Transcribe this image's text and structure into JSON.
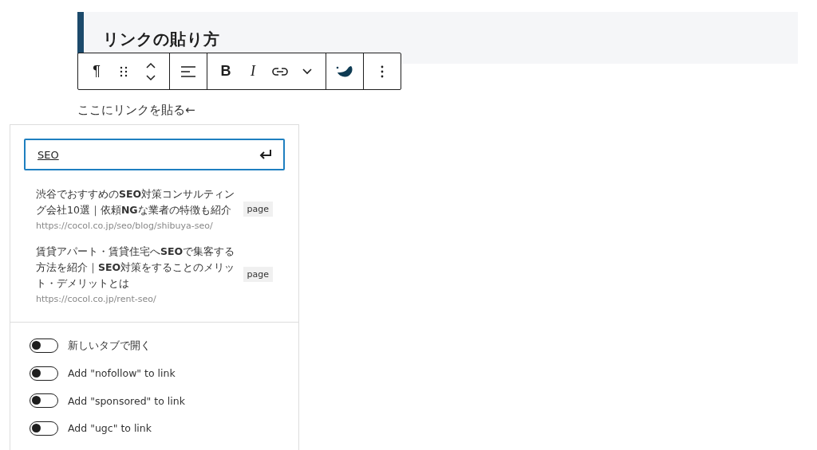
{
  "heading": {
    "text": "リンクの貼り方"
  },
  "toolbar": [
    {
      "items": [
        {
          "kind": "text",
          "label": "¶"
        },
        {
          "kind": "drag"
        },
        {
          "kind": "arrows"
        }
      ]
    },
    {
      "items": [
        {
          "kind": "align"
        }
      ]
    },
    {
      "items": [
        {
          "kind": "bold",
          "label": "B"
        },
        {
          "kind": "italic",
          "label": "I"
        },
        {
          "kind": "link"
        },
        {
          "kind": "chevron"
        }
      ]
    },
    {
      "items": [
        {
          "kind": "logo"
        }
      ]
    },
    {
      "items": [
        {
          "kind": "more"
        }
      ]
    }
  ],
  "paragraph": "ここにリンクを貼る←",
  "link_popover": {
    "search": {
      "value": "SEO"
    },
    "results": [
      {
        "title": "渋谷でおすすめの**SEO**対策コンサルティング会社10選｜依頼**NG**な業者の特徴も紹介",
        "url": "https://cocol.co.jp/seo/blog/shibuya-seo/",
        "badge": "page"
      },
      {
        "title": "賃貸アパート・賃貸住宅へ**SEO**で集客する方法を紹介｜**SEO**対策をすることのメリット・デメリットとは",
        "url": "https://cocol.co.jp/rent-seo/",
        "badge": "page"
      }
    ],
    "toggles": [
      {
        "label": "新しいタブで開く",
        "checked": false
      },
      {
        "label": "Add \"nofollow\" to link",
        "checked": false
      },
      {
        "label": "Add \"sponsored\" to link",
        "checked": false
      },
      {
        "label": "Add \"ugc\" to link",
        "checked": false
      }
    ]
  }
}
